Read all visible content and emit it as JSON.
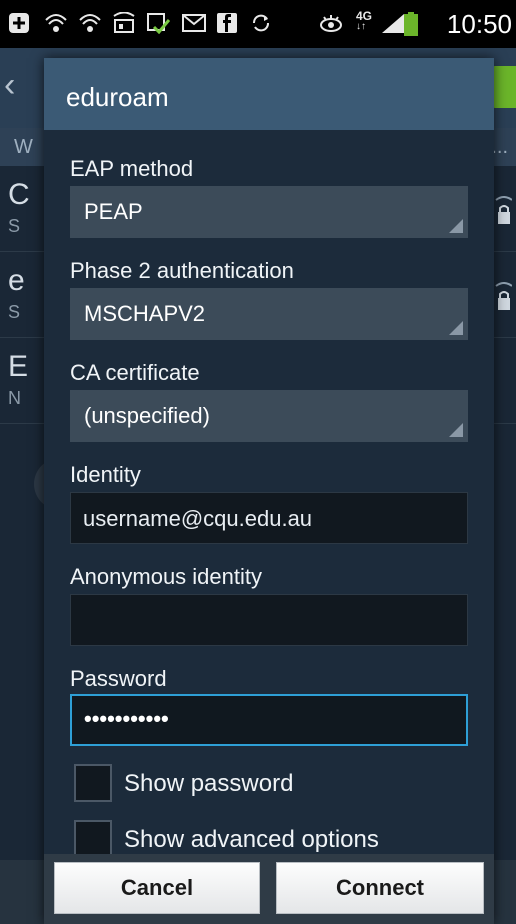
{
  "status_bar": {
    "time": "10:50",
    "network_type": "4G",
    "icons": [
      "add-icon",
      "wifi-calling-icon",
      "wifi-calling-icon",
      "sim-icon",
      "download-done-icon",
      "gmail-icon",
      "facebook-icon",
      "sync-icon",
      "smart-stay-eye-icon",
      "network-4g-icon",
      "signal-icon",
      "battery-icon"
    ]
  },
  "background_screen": {
    "subheader_left": "W",
    "subheader_right": "g...",
    "rows": [
      {
        "big": "C",
        "small": "S"
      },
      {
        "big": "e",
        "small": "S"
      },
      {
        "big": "E",
        "small": "N"
      }
    ]
  },
  "dialog": {
    "title": "eduroam",
    "eap_method": {
      "label": "EAP method",
      "value": "PEAP"
    },
    "phase2": {
      "label": "Phase 2 authentication",
      "value": "MSCHAPV2"
    },
    "ca_certificate": {
      "label": "CA certificate",
      "value": "(unspecified)"
    },
    "identity": {
      "label": "Identity",
      "value": "username@cqu.edu.au"
    },
    "anonymous_identity": {
      "label": "Anonymous identity",
      "value": ""
    },
    "password": {
      "label": "Password",
      "value": "•••••••••••"
    },
    "show_password": {
      "label": "Show password",
      "checked": false
    },
    "show_advanced": {
      "label": "Show advanced options",
      "checked": false
    },
    "cancel_label": "Cancel",
    "connect_label": "Connect"
  },
  "colors": {
    "accent_focus": "#2e9fd6",
    "title_bar": "#3b5a75",
    "dialog_bg": "#1c2b3b",
    "wifi_toggle": "#6bb52a"
  }
}
